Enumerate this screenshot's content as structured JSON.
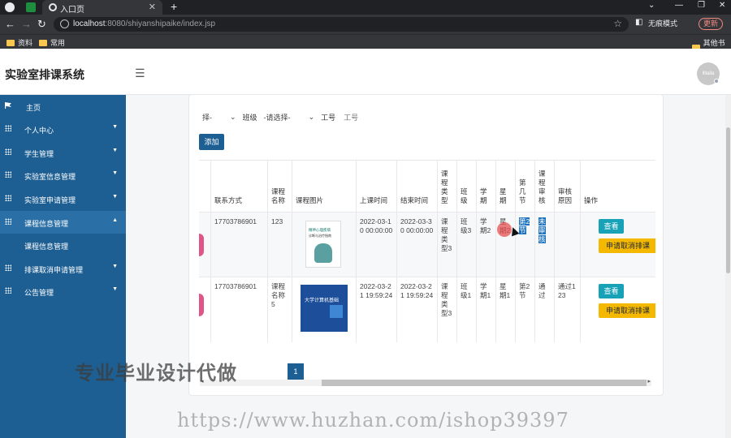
{
  "browser": {
    "tab_title": "入口页",
    "url_host": "localhost",
    "url_rest": ":8080/shiyanshipaike/index.jsp",
    "incognito_label": "无痕模式",
    "update_label": "更新",
    "bookmarks": [
      "资料",
      "常用"
    ],
    "other_bookmarks": "其他书签"
  },
  "header": {
    "brand": "实验室排课系统",
    "avatar_text": "llllalla"
  },
  "sidebar": {
    "items": [
      {
        "label": "主页"
      },
      {
        "label": "个人中心"
      },
      {
        "label": "学生管理"
      },
      {
        "label": "实验室信息管理"
      },
      {
        "label": "实验室申请管理"
      },
      {
        "label": "课程信息管理"
      },
      {
        "label": "课程信息管理"
      },
      {
        "label": "排课取消申请管理"
      },
      {
        "label": "公告管理"
      }
    ]
  },
  "filters": {
    "select1": "择-",
    "label_class": "班级",
    "select2": "-请选择-",
    "label_staff": "工号",
    "placeholder_staff": "工号"
  },
  "add_button": "添加",
  "table": {
    "headers": [
      "联系方式",
      "课程名称",
      "课程图片",
      "上课时间",
      "结束时间",
      "课程类型",
      "班级",
      "学期",
      "星期",
      "第几节",
      "课程审核",
      "审核原因",
      "操作"
    ],
    "rows": [
      {
        "phone": "17703786901",
        "course_name": "123",
        "image_title": "精神心理疾病",
        "image_sub": "诊断与治疗指南",
        "start": "2022-03-10 00:00:00",
        "end": "2022-03-30 00:00:00",
        "type": "课程类型3",
        "class": "班级3",
        "term": "学期2",
        "weekday": "星期2",
        "period": "第2节",
        "review": "未审核",
        "reason": "",
        "view": "查看",
        "cancel": "申请取消排课"
      },
      {
        "phone": "17703786901",
        "course_name": "课程名称5",
        "image_title": "大学计算机基础",
        "image_sub": "",
        "start": "2022-03-21 19:59:24",
        "end": "2022-03-21 19:59:24",
        "type": "课程类型3",
        "class": "班级1",
        "term": "学期1",
        "weekday": "星期1",
        "period": "第2节",
        "review": "通过",
        "reason": "通过123",
        "view": "查看",
        "cancel": "申请取消排课"
      }
    ]
  },
  "pagination": {
    "current": "1"
  },
  "watermarks": {
    "line1": "专业毕业设计代做",
    "line2": "https://www.huzhan.com/ishop39397"
  }
}
